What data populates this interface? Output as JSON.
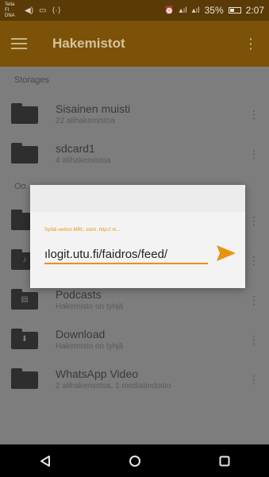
{
  "status_bar": {
    "carrier": "Telia FI DNA",
    "network_label": "Ⓡal",
    "battery_text": "35%",
    "time": "2:07"
  },
  "app_bar": {
    "title": "Hakemistot",
    "menu_icon": "hamburger-icon",
    "overflow_icon": "more-vert-icon"
  },
  "sections": {
    "storages": "Storages",
    "other": "Oo..."
  },
  "storages": [
    {
      "title": "Sisainen muisti",
      "subtitle": "22 alihakemistoa",
      "icon": "folder-icon"
    },
    {
      "title": "sdcard1",
      "subtitle": "4 alihakemistoa",
      "icon": "folder-icon"
    }
  ],
  "folders": [
    {
      "title": "",
      "subtitle": "",
      "icon": "folder-icon"
    },
    {
      "title": "",
      "subtitle": "",
      "icon": "music-folder-icon"
    },
    {
      "title": "Podcasts",
      "subtitle": "Hakemisto on tyhjä",
      "icon": "podcast-folder-icon"
    },
    {
      "title": "Download",
      "subtitle": "Hakemisto on tyhjä",
      "icon": "download-folder-icon"
    },
    {
      "title": "WhatsApp Video",
      "subtitle": "2 alihakemistoa, 1 mediatiedosto",
      "icon": "folder-icon"
    }
  ],
  "dialog": {
    "hint": "Syötä verkon MRL: esim. http:// m...",
    "value": "ılogit.utu.fi/faidros/feed/",
    "send_icon": "send-icon",
    "accent": "#e8930f"
  },
  "colors": {
    "app_bar": "#7c5208",
    "status_bar": "#5a3a06",
    "accent": "#e8930f"
  }
}
